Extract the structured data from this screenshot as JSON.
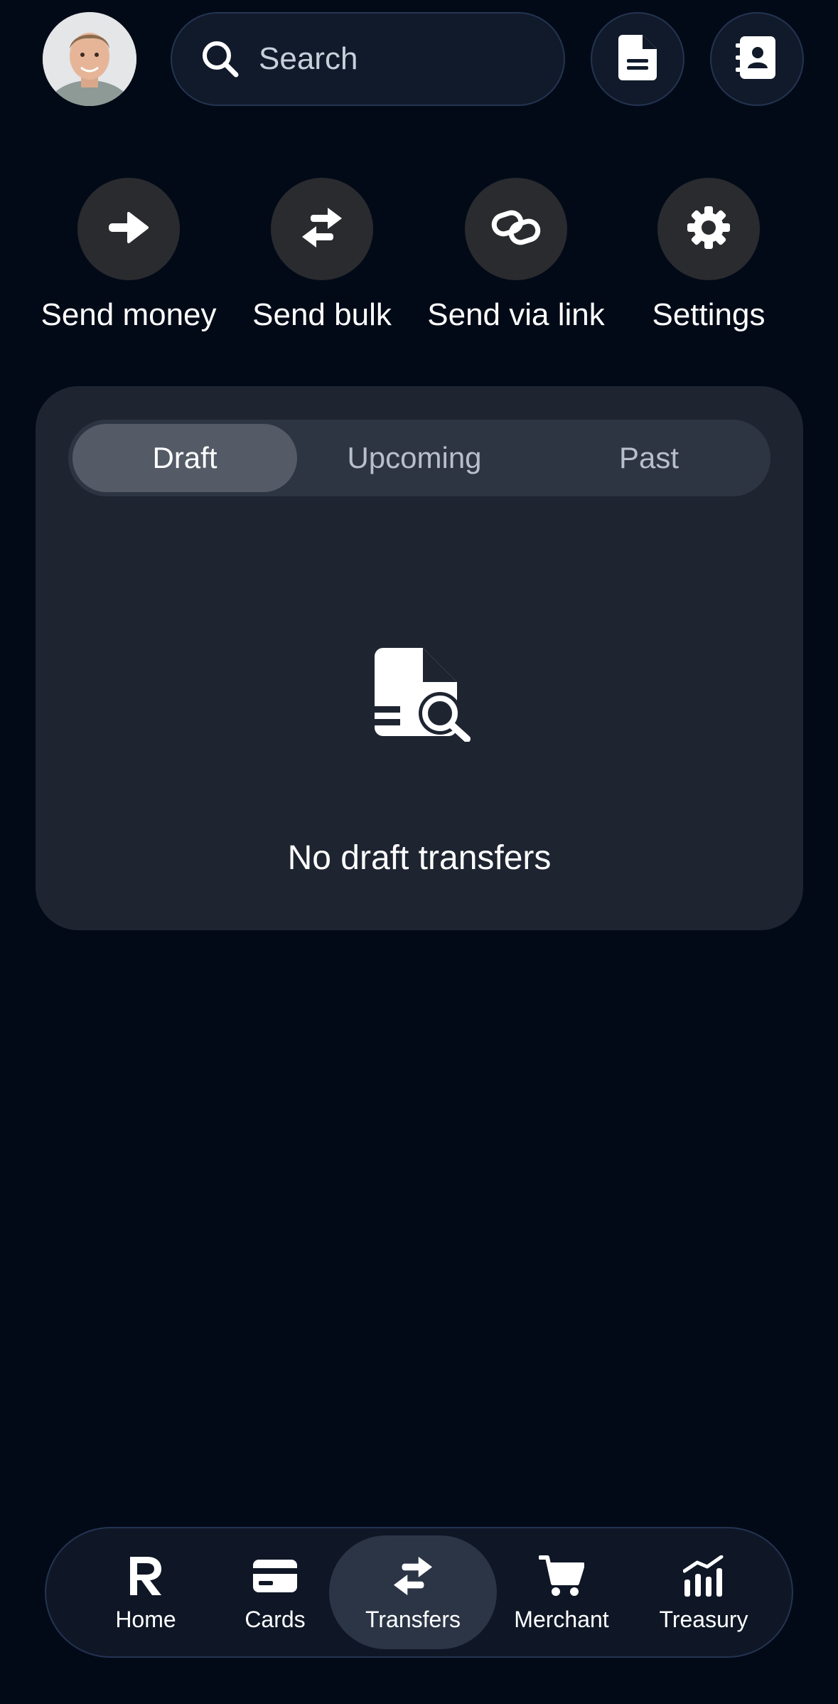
{
  "header": {
    "search_placeholder": "Search",
    "icons": [
      "search-icon",
      "document-icon",
      "contacts-icon"
    ]
  },
  "actions": [
    {
      "label": "Send money",
      "icon": "arrow-right-icon"
    },
    {
      "label": "Send bulk",
      "icon": "transfer-arrows-icon"
    },
    {
      "label": "Send via link",
      "icon": "link-icon"
    },
    {
      "label": "Settings",
      "icon": "gear-icon"
    }
  ],
  "transfers": {
    "tabs": [
      {
        "label": "Draft",
        "selected": true
      },
      {
        "label": "Upcoming",
        "selected": false
      },
      {
        "label": "Past",
        "selected": false
      }
    ],
    "empty_message": "No draft transfers",
    "empty_icon": "document-search-icon"
  },
  "nav": {
    "items": [
      {
        "label": "Home",
        "icon": "r-logo-icon",
        "active": false
      },
      {
        "label": "Cards",
        "icon": "card-icon",
        "active": false
      },
      {
        "label": "Transfers",
        "icon": "transfer-arrows-icon",
        "active": true
      },
      {
        "label": "Merchant",
        "icon": "cart-icon",
        "active": false
      },
      {
        "label": "Treasury",
        "icon": "chart-icon",
        "active": false
      }
    ]
  },
  "colors": {
    "background": "#030a17",
    "card": "#1e2531",
    "action_circle": "#2a2b2f",
    "segment_active": "#545b67"
  }
}
